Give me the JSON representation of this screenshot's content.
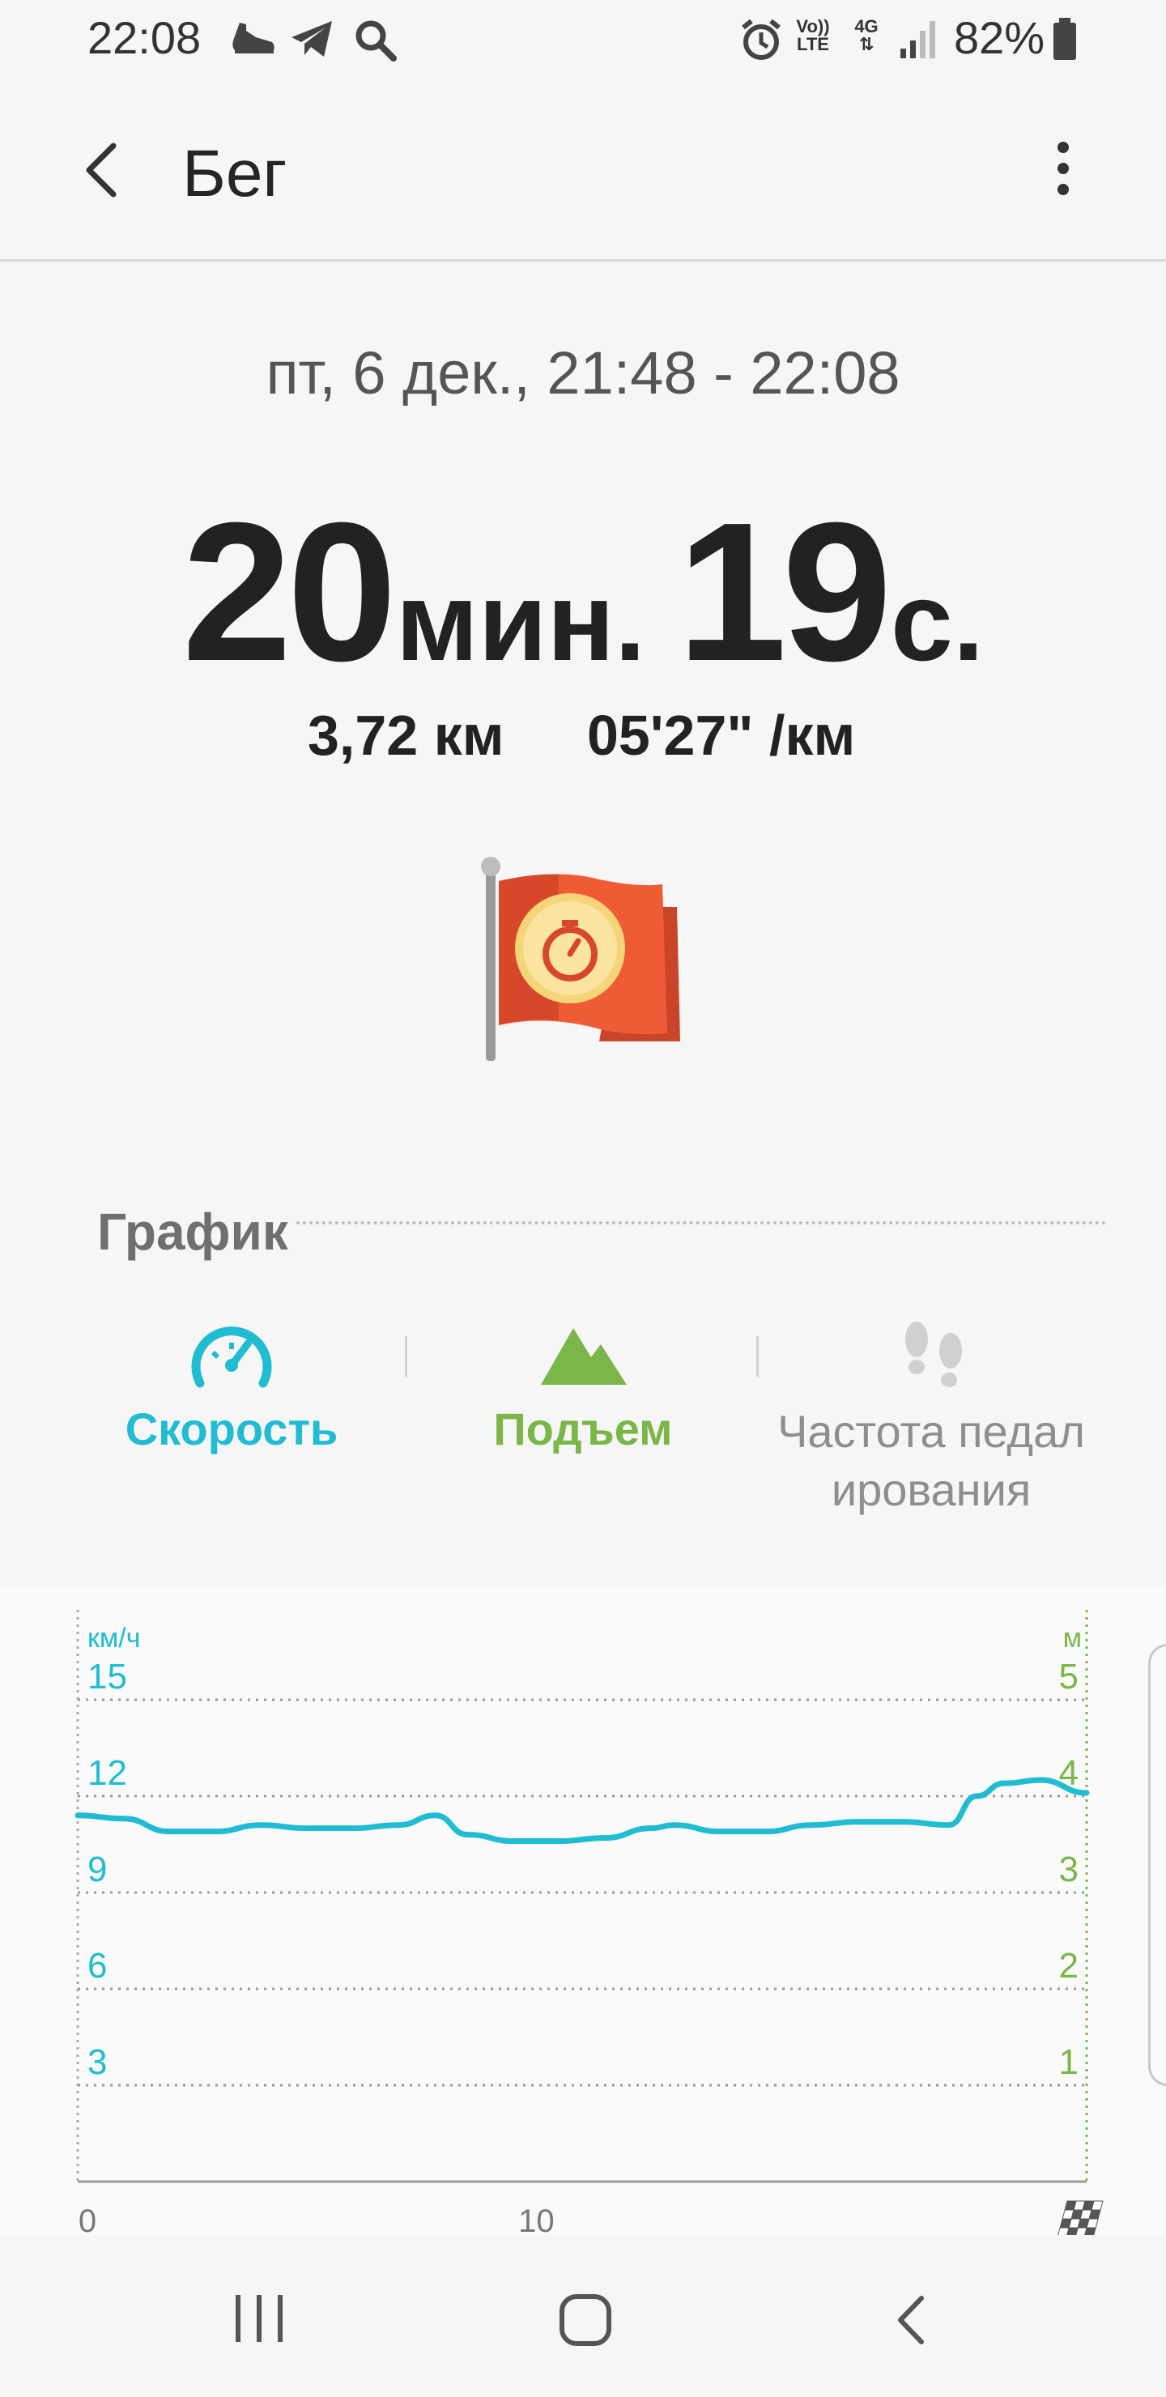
{
  "status_bar": {
    "time": "22:08",
    "battery": "82%",
    "network_top": "Vo))",
    "network_bottom": "LTE",
    "net_type": "4G"
  },
  "header": {
    "title": "Бег"
  },
  "summary": {
    "date_range": "пт, 6 дек., 21:48 - 22:08",
    "minutes_value": "20",
    "minutes_unit": "мин.",
    "seconds_value": "19",
    "seconds_unit": "с.",
    "distance": "3,72 км",
    "pace": "05'27\" /км"
  },
  "section": {
    "title": "График"
  },
  "tabs": [
    {
      "label": "Скорость",
      "icon": "speedometer-icon",
      "color": "#1fbcd2"
    },
    {
      "label": "Подъем",
      "icon": "mountain-icon",
      "color": "#7ab648"
    },
    {
      "label_line1": "Частота педал",
      "label_line2": "ирования",
      "icon": "footprints-icon",
      "color": "#8e8e8e"
    }
  ],
  "chart_data": {
    "type": "line",
    "left_axis_label": "км/ч",
    "right_axis_label": "м",
    "left_ticks": [
      "15",
      "12",
      "9",
      "6",
      "3"
    ],
    "right_ticks": [
      "5",
      "4",
      "3",
      "2",
      "1"
    ],
    "x_ticks": [
      "0",
      "10"
    ],
    "ylim": [
      0,
      18
    ],
    "xlim": [
      0,
      22
    ],
    "series": [
      {
        "color": "#1fbcd2",
        "x": [
          0,
          1,
          2,
          3,
          4,
          5,
          6,
          7,
          7.8,
          8.5,
          9.5,
          10.5,
          11.5,
          12.5,
          13,
          14,
          15,
          16,
          17,
          18,
          19,
          19.6,
          20.2,
          21,
          22
        ],
        "y": [
          11.4,
          11.3,
          10.9,
          10.9,
          11.1,
          11.0,
          11.0,
          11.1,
          11.4,
          10.8,
          10.6,
          10.6,
          10.7,
          11.0,
          11.1,
          10.9,
          10.9,
          11.1,
          11.2,
          11.2,
          11.1,
          12.0,
          12.4,
          12.5,
          12.1
        ]
      }
    ]
  }
}
